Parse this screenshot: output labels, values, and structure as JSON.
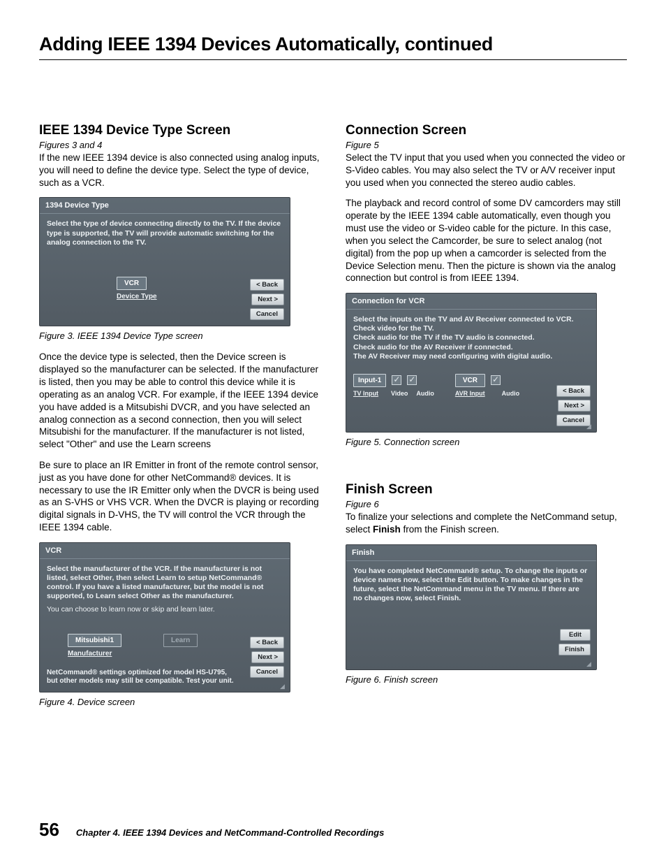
{
  "page_title": "Adding IEEE 1394 Devices Automatically, continued",
  "left": {
    "sec1_head": "IEEE 1394 Device Type Screen",
    "sec1_figref": "Figures 3 and 4",
    "sec1_p1": "If the new IEEE 1394 device is also connected using analog inputs, you will need to define the device type.  Select the type of device, such as a VCR.",
    "fig3": {
      "title": "1394 Device Type",
      "instr": "Select the type of device connecting directly to the TV.  If the device type is supported, the TV will provide automatic switching for the analog connection to the TV.",
      "field_value": "VCR",
      "field_label": "Device Type",
      "btn_back": "< Back",
      "btn_next": "Next >",
      "btn_cancel": "Cancel"
    },
    "fig3_caption": "Figure 3. IEEE 1394 Device Type screen",
    "sec1_p2": "Once the device type is selected, then the Device screen is displayed so the manufacturer can be selected. If the manufacturer is listed, then you may be able to control this device while it is operating as an analog VCR.  For example, if the IEEE 1394 device you have added is a Mitsubishi DVCR, and you have selected an analog connection as a second connection, then you will select Mitsubishi for the manufacturer.  If the manufacturer is not listed, select \"Other\" and use the Learn screens",
    "sec1_p3": "Be sure to place an IR Emitter in front of the remote control sensor, just as you have done for other NetCommand® devices.  It is necessary to use the IR Emitter only when the DVCR is being used as an S-VHS or VHS VCR.  When the DVCR is playing or recording digital signals in D-VHS, the TV will control the VCR through the IEEE 1394 cable.",
    "fig4": {
      "title": "VCR",
      "instr": "Select the manufacturer of the VCR.  If the manufacturer is not listed, select Other, then select Learn to setup NetCommand® control. If you have a listed manufacturer, but the model is not supported, to Learn select Other as the  manufacturer.",
      "infoline": "You can choose to learn now or skip and learn later.",
      "field_value": "Mitsubishi1",
      "learn_btn": "Learn",
      "field_label": "Manufacturer",
      "footer_l1": "NetCommand® settings optimized for model HS-U795,",
      "footer_l2": "but other models may still be compatible. Test your unit.",
      "btn_back": "< Back",
      "btn_next": "Next >",
      "btn_cancel": "Cancel"
    },
    "fig4_caption": "Figure 4.  Device  screen"
  },
  "right": {
    "sec2_head": "Connection Screen",
    "sec2_figref": "Figure 5",
    "sec2_p1": "Select the TV input that you used when you connected the video or S-Video cables.  You may also select the TV or A/V receiver input you used when you connected the stereo audio cables.",
    "sec2_p2": "The playback and record control of some DV camcorders may still operate by the IEEE 1394 cable automatically, even though you must use the video or S-video cable for the picture.  In this case, when you select the Camcorder, be sure to select analog (not digital) from the pop up when a camcorder is selected from the Device Selection menu.  Then the picture is shown via the analog connection but control is from IEEE 1394.",
    "fig5": {
      "title": "Connection for VCR",
      "instr_lines": [
        "Select the inputs on the TV and AV Receiver connected to VCR.",
        "Check video for the TV.",
        "Check audio for the TV if the TV audio is connected.",
        "Check audio for the AV Receiver if connected.",
        "The AV Receiver may need configuring with digital audio."
      ],
      "tv_input_value": "Input-1",
      "tv_input_label": "TV Input",
      "video_label": "Video",
      "audio_label": "Audio",
      "avr_value": "VCR",
      "avr_label": "AVR Input",
      "btn_back": "< Back",
      "btn_next": "Next >",
      "btn_cancel": "Cancel"
    },
    "fig5_caption": "Figure 5. Connection screen",
    "sec3_head": "Finish Screen",
    "sec3_figref": "Figure 6",
    "sec3_p1_a": "To finalize your selections and complete the NetCommand setup, select ",
    "sec3_p1_b": "Finish",
    "sec3_p1_c": " from the Finish screen.",
    "fig6": {
      "title": "Finish",
      "instr": "You have completed NetCommand® setup.  To change the inputs or device names now, select the Edit button.  To make changes in the future, select the NetCommand menu in the TV menu.  If there are no changes now, select Finish.",
      "btn_edit": "Edit",
      "btn_finish": "Finish"
    },
    "fig6_caption": "Figure 6. Finish screen"
  },
  "footer": {
    "page_number": "56",
    "chapter": "Chapter 4. IEEE 1394 Devices and NetCommand-Controlled Recordings"
  }
}
